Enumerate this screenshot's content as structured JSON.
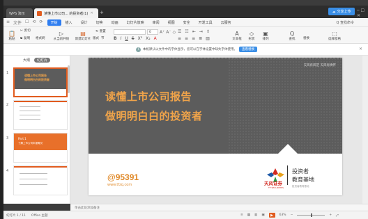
{
  "titlebar": {
    "home_tab": "WPS 演示",
    "doc_tab": "读懂上市公司... 的投资者(1)",
    "close_glyph": "✕",
    "plus_glyph": "+",
    "share_label": "分享上传"
  },
  "menubar": {
    "quick_icons": [
      "≡",
      "文件",
      "☐",
      "⟲",
      "⟳"
    ],
    "items": [
      "开始",
      "插入",
      "设计",
      "切换",
      "动画",
      "幻灯片放映",
      "审阅",
      "视图",
      "安全",
      "开发工具",
      "云服务"
    ],
    "active": "开始",
    "search": "Q 查找命令"
  },
  "ribbon": {
    "paste": "粘贴",
    "cut": "剪切",
    "copy": "复制",
    "format_painter": "格式刷",
    "from_start": "从当前开始",
    "new_slide": "新建幻灯片",
    "layout": "版式",
    "section": "节",
    "reset": "重置",
    "font_size": "0",
    "text_box": "文本框",
    "shape": "形状",
    "arrange": "排列",
    "find": "查找",
    "replace": "替换",
    "select": "选择窗格",
    "icon_paste": "📋",
    "icon_new": "▤",
    "icon_textbox": "A",
    "icon_shape": "◇",
    "icon_find": "Q"
  },
  "notice": {
    "text": "本机默认以文件中的字体显示，您可以在字体设置中缺失字体使用。",
    "button": "查看替换"
  },
  "leftpanel": {
    "tabs": [
      "大纲",
      "幻灯片"
    ],
    "slide_numbers": [
      "1",
      "2",
      "3",
      "4"
    ],
    "thumb1_title_line1": "读懂上市公司报告",
    "thumb1_title_line2": "做明明白白的投资者",
    "thumb3_part": "Part 1",
    "thumb3_title": "了解上市公司年报概况"
  },
  "slide": {
    "slogan": "天风有风范  天风有情怀",
    "title_line1": "读懂上市公司报告",
    "title_line2": "做明明白白的投资者",
    "phone": "@95391",
    "website": "www.tfzq.com",
    "logo_name": "天风证券",
    "logo_sub": "TF SECURITIES",
    "edu_line1": "投资者",
    "edu_line2": "教育基地",
    "edu_sub": "投资者教育基地"
  },
  "notes": {
    "text": "单击此处添加备注"
  },
  "statusbar": {
    "slide_count": "幻灯片 1 / 11",
    "theme": "Office 主题",
    "zoom": "63%",
    "view_icons": [
      "≡",
      "▦",
      "▥",
      "▣"
    ]
  },
  "colors": {
    "accent": "#e15c1f",
    "title": "#f0a44a",
    "blue": "#3a8ee6"
  }
}
